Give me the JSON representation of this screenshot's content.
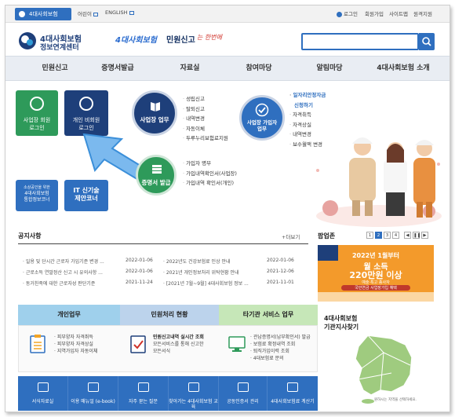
{
  "topbar": {
    "site_tab": "4대사회보험",
    "kids": "어린이",
    "english": "ENGLISH",
    "login": "로그인",
    "join": "회원가입",
    "sitemap": "사이트맵",
    "remote": "원격지원"
  },
  "header": {
    "logo_line1": "4대사회보험",
    "logo_line2": "정보연계센터",
    "slogan_part1": "4대사회보험",
    "slogan_part2": "민원신고",
    "slogan_part3": "는 한번에",
    "search_placeholder": ""
  },
  "nav": {
    "items": [
      "민원신고",
      "증명서발급",
      "자료실",
      "참여마당",
      "알림마당",
      "4대사회보험 소개"
    ]
  },
  "login_tiles": {
    "business_line1": "사업장 회원",
    "business_line2": "로그인",
    "personal_line1": "개인 비회원",
    "personal_line2": "로그인"
  },
  "promo_tiles": {
    "integrated_line1": "소상공인을 위한",
    "integrated_line2": "4대사회보험",
    "integrated_line3": "통합정보코너",
    "it_line1": "IT 신기술",
    "it_line2": "제안코너"
  },
  "business_task": {
    "label": "사업장 업무",
    "items": [
      "성립신고",
      "탈퇴신고",
      "내역변경",
      "자동이체",
      "두루누리보험료지원"
    ]
  },
  "subscriber_task": {
    "label_line1": "사업장 가입자",
    "label_line2": "업무",
    "items": [
      "일자리안정자금",
      "신청하기",
      "자격취득",
      "자격상실",
      "내역변경",
      "보수월액 변경"
    ]
  },
  "certificate": {
    "label": "증명서 발급",
    "items": [
      "가입자 명부",
      "가입내역확인서(사업장)",
      "가입내역 확인서(개인)"
    ]
  },
  "notices": {
    "title": "공지사항",
    "more": "+더보기",
    "left": [
      {
        "text": "일용 및 단시간 근로자 가입기준 변경 ...",
        "date": "2022-01-06"
      },
      {
        "text": "근로소득 연말정산 신고 시 유의사항 ...",
        "date": "2022-01-06"
      },
      {
        "text": "동거친족에 대한 근로자성 판단기준",
        "date": "2021-11-24"
      }
    ],
    "right": [
      {
        "text": "2022년도 건강보험료 인상 안내",
        "date": "2022-01-06"
      },
      {
        "text": "2021년 개인정보처리 위탁현황 안내",
        "date": "2021-12-06"
      },
      {
        "text": "[2021년 7월~9월] 4대사회보험 정보 ...",
        "date": "2021-11-01"
      }
    ]
  },
  "popup": {
    "title": "팝업존",
    "pages": [
      "1",
      "2",
      "3",
      "4"
    ],
    "banner_year": "2022년 1월부터",
    "banner_main1": "월 소득",
    "banner_main2": "220만원 이상",
    "banner_small1": "예술·특고 종사자",
    "banner_small2": "국민연금 사업장가입 혜택"
  },
  "services": {
    "tab1": "개인업무",
    "tab2": "민원처리 현황",
    "tab3": "타기관 서비스 업무",
    "personal": [
      "피부양자 자격취득",
      "피부양자 자격상실",
      "지역가입자 자동이체"
    ],
    "status_title": "민원신고내역 실시간 조회",
    "status_desc1": "모든서비스를 통해 신고한",
    "status_desc2": "모든서식",
    "other": [
      "관납증명서(납부확인서) 발급",
      "보험료 확정내역 조회",
      "퇴직가입이력 조회",
      "4대보험료 문의"
    ]
  },
  "bottom_tiles": [
    "서식자료실",
    "이용 매뉴얼 (e-book)",
    "자주 묻는 질문",
    "찾아가는 4대사회보험 교육",
    "공동인증서 관리",
    "4대사회보험료 계산기"
  ],
  "map": {
    "title_line1": "4대사회보험",
    "title_line2": "기관지사찾기",
    "caption": "원하시는 지역을 선택하세요."
  },
  "colors": {
    "primary": "#2f6fbf",
    "green": "#2e9a5a",
    "navy": "#1e3f7a"
  }
}
